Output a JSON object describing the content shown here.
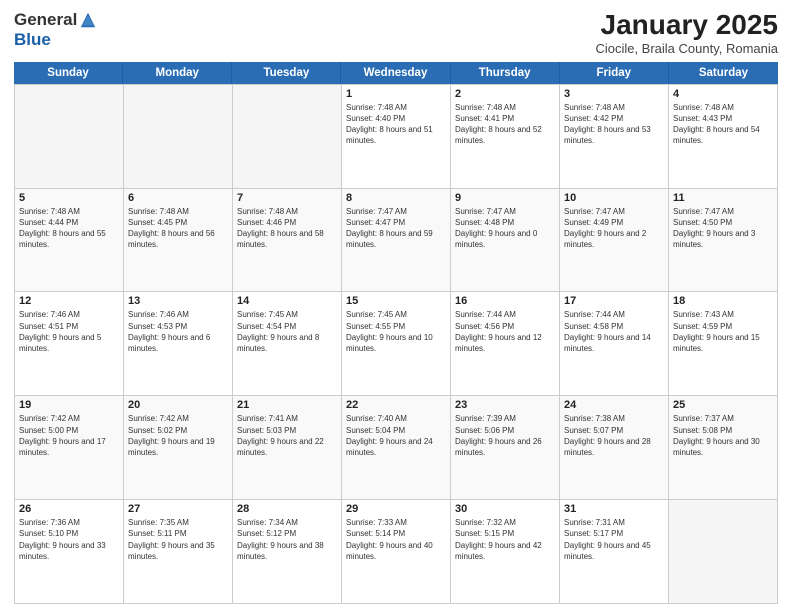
{
  "logo": {
    "general": "General",
    "blue": "Blue"
  },
  "title": "January 2025",
  "subtitle": "Ciocile, Braila County, Romania",
  "days": [
    "Sunday",
    "Monday",
    "Tuesday",
    "Wednesday",
    "Thursday",
    "Friday",
    "Saturday"
  ],
  "cells": [
    {
      "day": null,
      "empty": true,
      "row": 0
    },
    {
      "day": null,
      "empty": true,
      "row": 0
    },
    {
      "day": null,
      "empty": true,
      "row": 0
    },
    {
      "day": "1",
      "empty": false,
      "row": 0,
      "info": "Sunrise: 7:48 AM\nSunset: 4:40 PM\nDaylight: 8 hours and 51 minutes."
    },
    {
      "day": "2",
      "empty": false,
      "row": 0,
      "info": "Sunrise: 7:48 AM\nSunset: 4:41 PM\nDaylight: 8 hours and 52 minutes."
    },
    {
      "day": "3",
      "empty": false,
      "row": 0,
      "info": "Sunrise: 7:48 AM\nSunset: 4:42 PM\nDaylight: 8 hours and 53 minutes."
    },
    {
      "day": "4",
      "empty": false,
      "row": 0,
      "info": "Sunrise: 7:48 AM\nSunset: 4:43 PM\nDaylight: 8 hours and 54 minutes."
    },
    {
      "day": "5",
      "empty": false,
      "row": 1,
      "info": "Sunrise: 7:48 AM\nSunset: 4:44 PM\nDaylight: 8 hours and 55 minutes."
    },
    {
      "day": "6",
      "empty": false,
      "row": 1,
      "info": "Sunrise: 7:48 AM\nSunset: 4:45 PM\nDaylight: 8 hours and 56 minutes."
    },
    {
      "day": "7",
      "empty": false,
      "row": 1,
      "info": "Sunrise: 7:48 AM\nSunset: 4:46 PM\nDaylight: 8 hours and 58 minutes."
    },
    {
      "day": "8",
      "empty": false,
      "row": 1,
      "info": "Sunrise: 7:47 AM\nSunset: 4:47 PM\nDaylight: 8 hours and 59 minutes."
    },
    {
      "day": "9",
      "empty": false,
      "row": 1,
      "info": "Sunrise: 7:47 AM\nSunset: 4:48 PM\nDaylight: 9 hours and 0 minutes."
    },
    {
      "day": "10",
      "empty": false,
      "row": 1,
      "info": "Sunrise: 7:47 AM\nSunset: 4:49 PM\nDaylight: 9 hours and 2 minutes."
    },
    {
      "day": "11",
      "empty": false,
      "row": 1,
      "info": "Sunrise: 7:47 AM\nSunset: 4:50 PM\nDaylight: 9 hours and 3 minutes."
    },
    {
      "day": "12",
      "empty": false,
      "row": 2,
      "info": "Sunrise: 7:46 AM\nSunset: 4:51 PM\nDaylight: 9 hours and 5 minutes."
    },
    {
      "day": "13",
      "empty": false,
      "row": 2,
      "info": "Sunrise: 7:46 AM\nSunset: 4:53 PM\nDaylight: 9 hours and 6 minutes."
    },
    {
      "day": "14",
      "empty": false,
      "row": 2,
      "info": "Sunrise: 7:45 AM\nSunset: 4:54 PM\nDaylight: 9 hours and 8 minutes."
    },
    {
      "day": "15",
      "empty": false,
      "row": 2,
      "info": "Sunrise: 7:45 AM\nSunset: 4:55 PM\nDaylight: 9 hours and 10 minutes."
    },
    {
      "day": "16",
      "empty": false,
      "row": 2,
      "info": "Sunrise: 7:44 AM\nSunset: 4:56 PM\nDaylight: 9 hours and 12 minutes."
    },
    {
      "day": "17",
      "empty": false,
      "row": 2,
      "info": "Sunrise: 7:44 AM\nSunset: 4:58 PM\nDaylight: 9 hours and 14 minutes."
    },
    {
      "day": "18",
      "empty": false,
      "row": 2,
      "info": "Sunrise: 7:43 AM\nSunset: 4:59 PM\nDaylight: 9 hours and 15 minutes."
    },
    {
      "day": "19",
      "empty": false,
      "row": 3,
      "info": "Sunrise: 7:42 AM\nSunset: 5:00 PM\nDaylight: 9 hours and 17 minutes."
    },
    {
      "day": "20",
      "empty": false,
      "row": 3,
      "info": "Sunrise: 7:42 AM\nSunset: 5:02 PM\nDaylight: 9 hours and 19 minutes."
    },
    {
      "day": "21",
      "empty": false,
      "row": 3,
      "info": "Sunrise: 7:41 AM\nSunset: 5:03 PM\nDaylight: 9 hours and 22 minutes."
    },
    {
      "day": "22",
      "empty": false,
      "row": 3,
      "info": "Sunrise: 7:40 AM\nSunset: 5:04 PM\nDaylight: 9 hours and 24 minutes."
    },
    {
      "day": "23",
      "empty": false,
      "row": 3,
      "info": "Sunrise: 7:39 AM\nSunset: 5:06 PM\nDaylight: 9 hours and 26 minutes."
    },
    {
      "day": "24",
      "empty": false,
      "row": 3,
      "info": "Sunrise: 7:38 AM\nSunset: 5:07 PM\nDaylight: 9 hours and 28 minutes."
    },
    {
      "day": "25",
      "empty": false,
      "row": 3,
      "info": "Sunrise: 7:37 AM\nSunset: 5:08 PM\nDaylight: 9 hours and 30 minutes."
    },
    {
      "day": "26",
      "empty": false,
      "row": 4,
      "info": "Sunrise: 7:36 AM\nSunset: 5:10 PM\nDaylight: 9 hours and 33 minutes."
    },
    {
      "day": "27",
      "empty": false,
      "row": 4,
      "info": "Sunrise: 7:35 AM\nSunset: 5:11 PM\nDaylight: 9 hours and 35 minutes."
    },
    {
      "day": "28",
      "empty": false,
      "row": 4,
      "info": "Sunrise: 7:34 AM\nSunset: 5:12 PM\nDaylight: 9 hours and 38 minutes."
    },
    {
      "day": "29",
      "empty": false,
      "row": 4,
      "info": "Sunrise: 7:33 AM\nSunset: 5:14 PM\nDaylight: 9 hours and 40 minutes."
    },
    {
      "day": "30",
      "empty": false,
      "row": 4,
      "info": "Sunrise: 7:32 AM\nSunset: 5:15 PM\nDaylight: 9 hours and 42 minutes."
    },
    {
      "day": "31",
      "empty": false,
      "row": 4,
      "info": "Sunrise: 7:31 AM\nSunset: 5:17 PM\nDaylight: 9 hours and 45 minutes."
    },
    {
      "day": null,
      "empty": true,
      "row": 4
    }
  ]
}
